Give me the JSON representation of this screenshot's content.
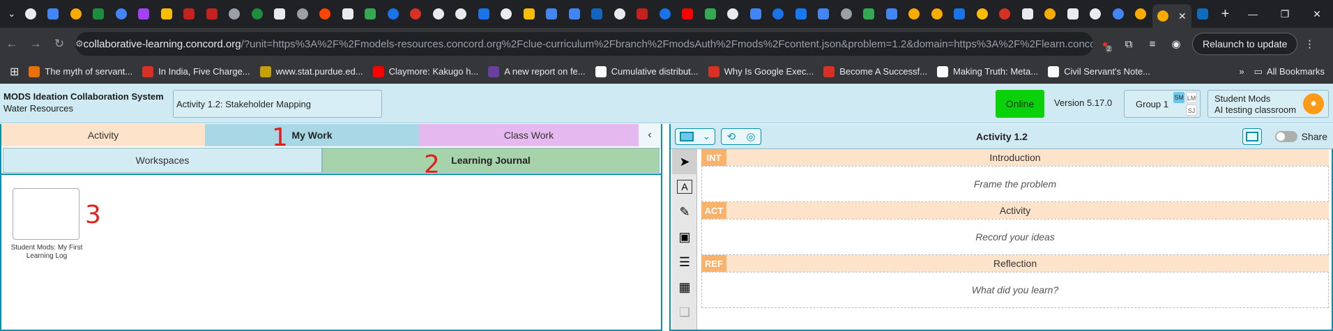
{
  "browser": {
    "url_host": "collaborative-learning.concord.org",
    "url_path": "/?unit=https%3A%2F%2Fmodels-resources.concord.org%2Fclue-curriculum%2Fbranch%2FmodsAuth%2Fmods%2Fcontent.json&problem=1.2&domain=https%3A%2F%2Flearn.concord.org...",
    "relaunch_label": "Relaunch to update",
    "extension_badge": "2",
    "bookmarks": [
      {
        "label": "The myth of servant...",
        "color": "#e8710a"
      },
      {
        "label": "In India, Five Charge...",
        "color": "#d93025"
      },
      {
        "label": "www.stat.purdue.ed...",
        "color": "#c5a000"
      },
      {
        "label": "Claymore: Kakugo h...",
        "color": "#ff0000"
      },
      {
        "label": "A new report on fe...",
        "color": "#6b3fa0"
      },
      {
        "label": "Cumulative distribut...",
        "color": "#ffffff"
      },
      {
        "label": "Why Is Google Exec...",
        "color": "#d93025"
      },
      {
        "label": "Become A Successf...",
        "color": "#d93025"
      },
      {
        "label": "Making Truth: Meta...",
        "color": "#ffffff"
      },
      {
        "label": "Civil Servant's Note...",
        "color": "#ffffff"
      }
    ],
    "all_bookmarks_label": "All Bookmarks"
  },
  "header": {
    "title": "MODS Ideation Collaboration System",
    "subtitle": "Water Resources",
    "activity": "Activity 1.2: Stakeholder Mapping",
    "status": "Online",
    "version": "Version 5.17.0",
    "group": "Group 1",
    "group_members": [
      "SM",
      "LM",
      "SJ"
    ],
    "user_name": "Student Mods",
    "user_class": "AI testing classroom"
  },
  "left": {
    "tabs": [
      "Activity",
      "My Work",
      "Class Work"
    ],
    "collapse_icon": "chevron-left-icon",
    "subtabs": [
      "Workspaces",
      "Learning Journal"
    ],
    "thumbnail_label": "Student Mods: My First Learning Log"
  },
  "annotations": [
    "1",
    "2",
    "3"
  ],
  "right": {
    "title": "Activity 1.2",
    "share_label": "Share",
    "sections": [
      {
        "tag": "INT",
        "title": "Introduction",
        "prompt": "Frame the problem"
      },
      {
        "tag": "ACT",
        "title": "Activity",
        "prompt": "Record your ideas"
      },
      {
        "tag": "REF",
        "title": "Reflection",
        "prompt": "What did you learn?"
      }
    ],
    "tools": [
      "pointer-icon",
      "text-icon",
      "draw-icon",
      "image-icon",
      "document-icon",
      "table-icon",
      "copy-icon"
    ]
  },
  "colors": {
    "online": "#0ad10a",
    "accent": "#0591aa",
    "header_bg": "#cfeaf2"
  }
}
